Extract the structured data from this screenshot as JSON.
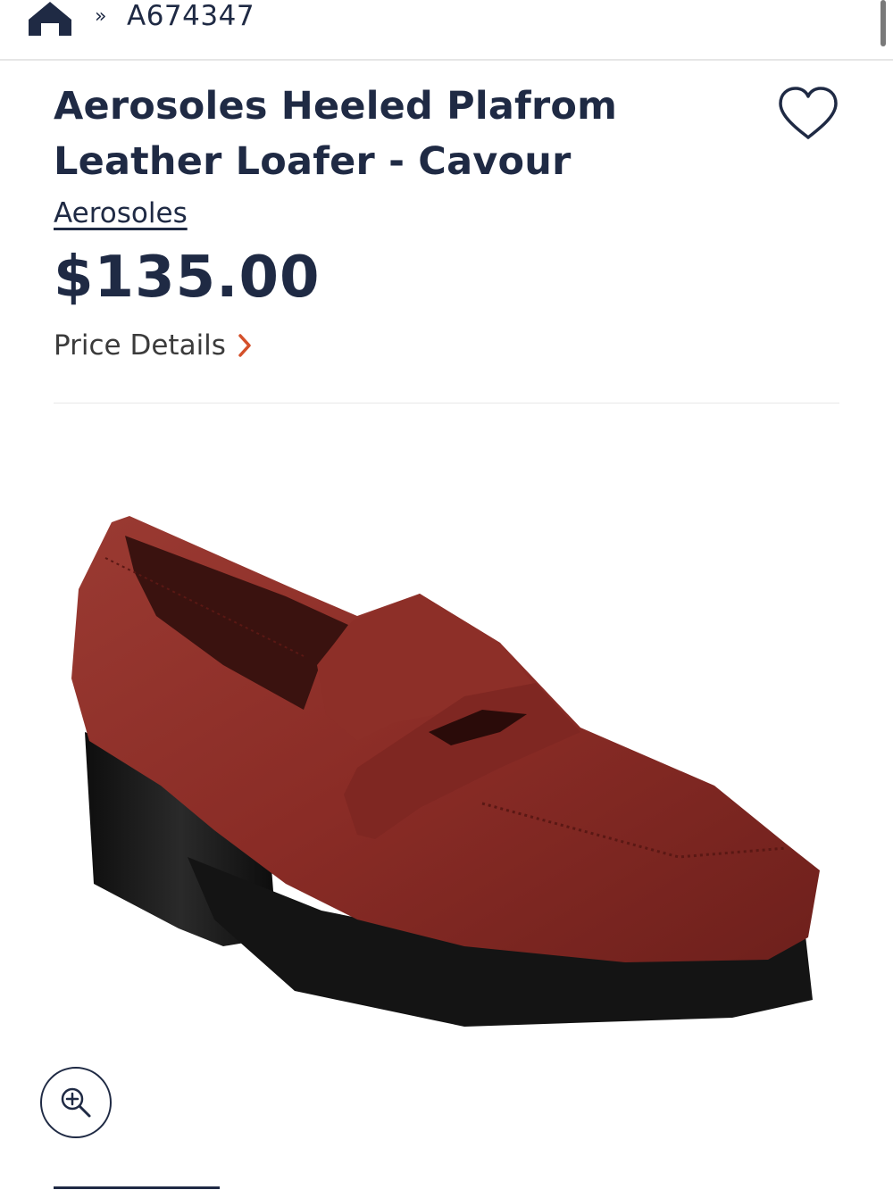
{
  "breadcrumb": {
    "home_icon": "home-icon",
    "separator": "»",
    "product_id": "A674347"
  },
  "product": {
    "title": "Aerosoles Heeled Plafrom Leather Loafer - Cavour",
    "brand": "Aerosoles",
    "price": "$135.00",
    "price_details_label": "Price Details",
    "wishlist_icon": "heart-icon"
  },
  "image": {
    "zoom_icon": "zoom-in-icon",
    "upper_color": "#8a2c26",
    "sole_color": "#151515"
  },
  "colors": {
    "text": "#1f2a44",
    "accent": "#d4502a"
  }
}
